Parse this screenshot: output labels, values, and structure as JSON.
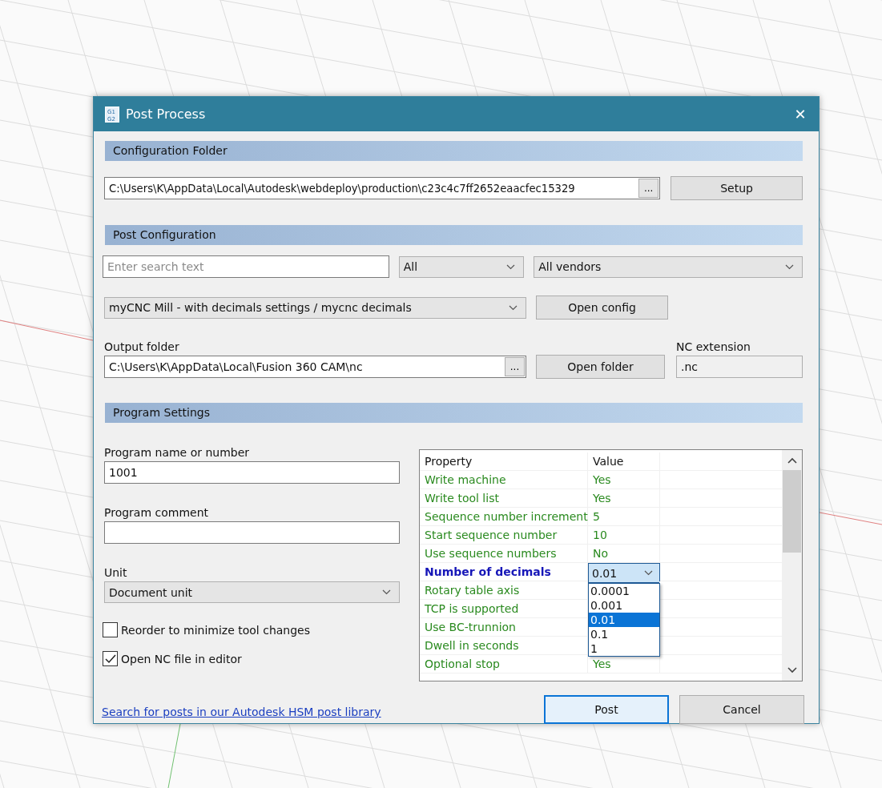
{
  "window": {
    "title": "Post Process",
    "icon_text": [
      "G1",
      "G2"
    ],
    "close": "✕"
  },
  "configuration_folder": {
    "header": "Configuration Folder",
    "path": "C:\\Users\\K\\AppData\\Local\\Autodesk\\webdeploy\\production\\c23c4c7ff2652eaacfec15329",
    "browse": "...",
    "button": "Setup"
  },
  "post_configuration": {
    "header": "Post Configuration",
    "search": {
      "placeholder": "Enter search text"
    },
    "filter": "All",
    "vendor": "All vendors",
    "post": "myCNC Mill - with decimals settings / mycnc decimals",
    "open_config": "Open config",
    "output_label": "Output folder",
    "output_path": "C:\\Users\\K\\AppData\\Local\\Fusion 360 CAM\\nc",
    "output_browse": "...",
    "open_folder": "Open folder",
    "ext_label": "NC extension",
    "ext_value": ".nc"
  },
  "program_settings": {
    "header": "Program Settings",
    "name_label": "Program name or number",
    "name_value": "1001",
    "comment_label": "Program comment",
    "unit_label": "Unit",
    "unit_value": "Document unit",
    "checkboxes": [
      {
        "label": "Reorder to minimize tool changes",
        "checked": false
      },
      {
        "label": "Open NC file in editor",
        "checked": true
      }
    ]
  },
  "properties": {
    "columns": [
      "Property",
      "Value"
    ],
    "rows": [
      {
        "name": "Write machine",
        "value": "Yes",
        "selected": false
      },
      {
        "name": "Write tool list",
        "value": "Yes",
        "selected": false
      },
      {
        "name": "Sequence number increment",
        "value": "5",
        "selected": false
      },
      {
        "name": "Start sequence number",
        "value": "10",
        "selected": false
      },
      {
        "name": "Use sequence numbers",
        "value": "No",
        "selected": false
      },
      {
        "name": "Number of decimals",
        "value": "0.01",
        "selected": true,
        "expanded": true,
        "options": [
          {
            "label": "0.0001",
            "selected": false
          },
          {
            "label": "0.001",
            "selected": false
          },
          {
            "label": "0.01",
            "selected": true
          },
          {
            "label": "0.1",
            "selected": false
          },
          {
            "label": "1",
            "selected": false
          }
        ]
      },
      {
        "name": "Rotary table axis",
        "selected": false
      },
      {
        "name": "TCP is supported",
        "selected": false
      },
      {
        "name": "Use BC-trunnion",
        "selected": false
      },
      {
        "name": "Dwell in seconds",
        "selected": false
      },
      {
        "name": "Optional stop",
        "value": "Yes",
        "selected": false
      }
    ]
  },
  "link": "Search for posts in our Autodesk HSM post library",
  "buttons": [
    {
      "label": "Post",
      "default": true
    },
    {
      "label": "Cancel",
      "default": false
    }
  ]
}
